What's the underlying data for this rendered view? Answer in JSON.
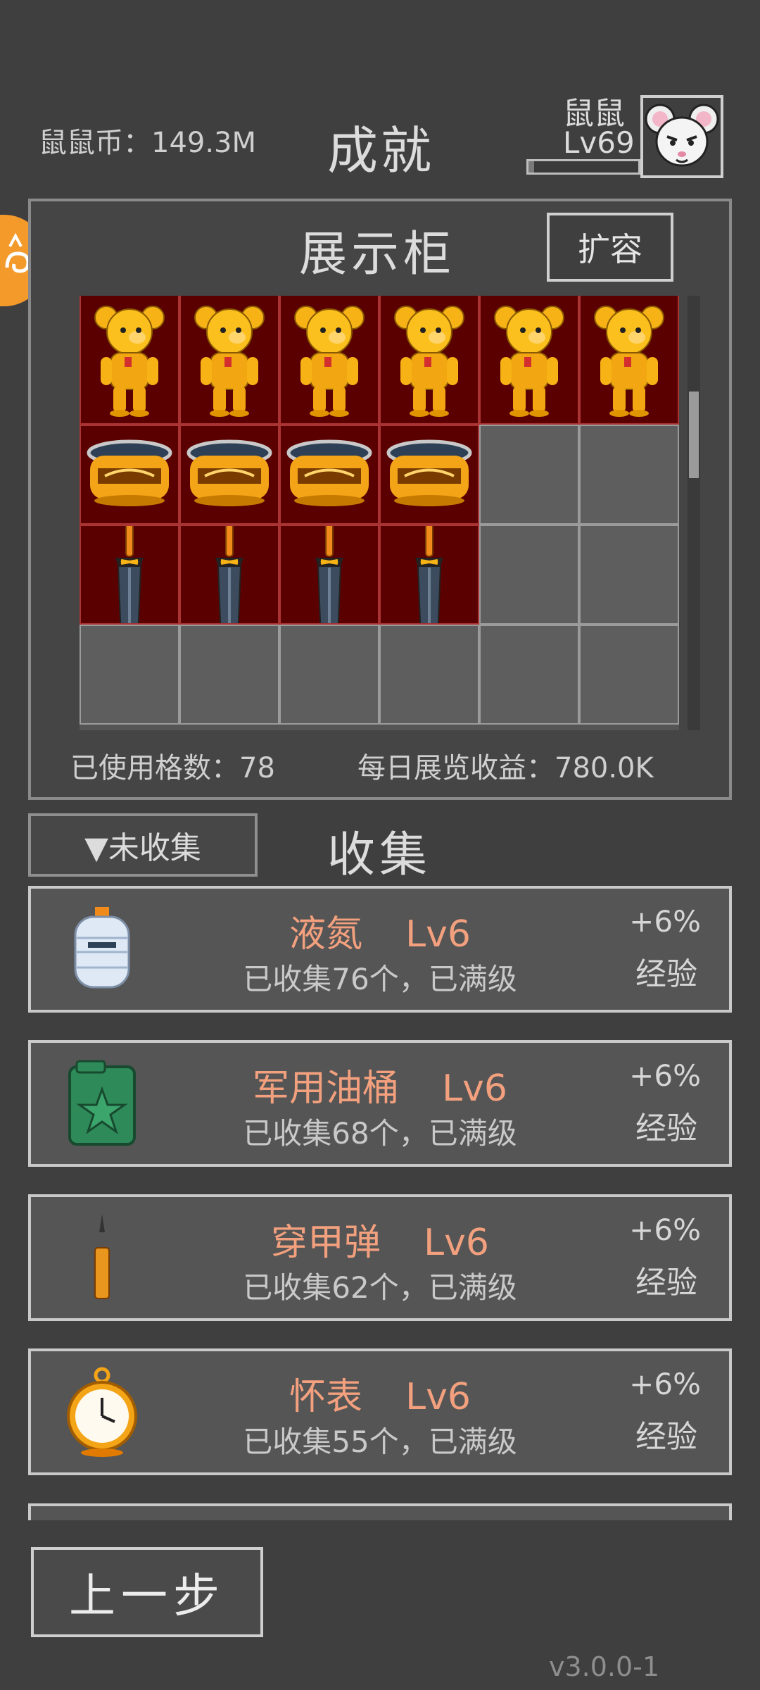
{
  "header": {
    "coins_label": "鼠鼠币：149.3M",
    "title": "成就",
    "player_name": "鼠鼠",
    "player_level": "Lv69",
    "xp_fraction": 0.05
  },
  "cabinet": {
    "title": "展示柜",
    "expand_label": "扩容",
    "used_slots_label": "已使用格数：78",
    "daily_income_label": "每日展览收益：780.0K",
    "rows": [
      {
        "item": "golden-bear",
        "filled": 6
      },
      {
        "item": "golden-jar",
        "filled": 4
      },
      {
        "item": "sword",
        "filled": 4
      }
    ],
    "columns": 6,
    "scroll_fraction": 0.22
  },
  "collection": {
    "filter_label": "▼未收集",
    "title": "收集",
    "items": [
      {
        "name": "液氮",
        "level": "Lv6",
        "desc": "已收集76个，已满级",
        "bonus": "+6%",
        "bonus_label": "经验",
        "icon": "liquid-nitrogen-tank-icon"
      },
      {
        "name": "军用油桶",
        "level": "Lv6",
        "desc": "已收集68个，已满级",
        "bonus": "+6%",
        "bonus_label": "经验",
        "icon": "jerrycan-icon"
      },
      {
        "name": "穿甲弹",
        "level": "Lv6",
        "desc": "已收集62个，已满级",
        "bonus": "+6%",
        "bonus_label": "经验",
        "icon": "ap-round-icon"
      },
      {
        "name": "怀表",
        "level": "Lv6",
        "desc": "已收集55个，已满级",
        "bonus": "+6%",
        "bonus_label": "经验",
        "icon": "pocket-watch-icon"
      }
    ]
  },
  "footer": {
    "back_label": "上一步",
    "version": "v3.0.0-1"
  },
  "colors": {
    "background": "#3f3f3f",
    "accent_name": "#f3a07e",
    "filled_slot": "#5a0000"
  }
}
